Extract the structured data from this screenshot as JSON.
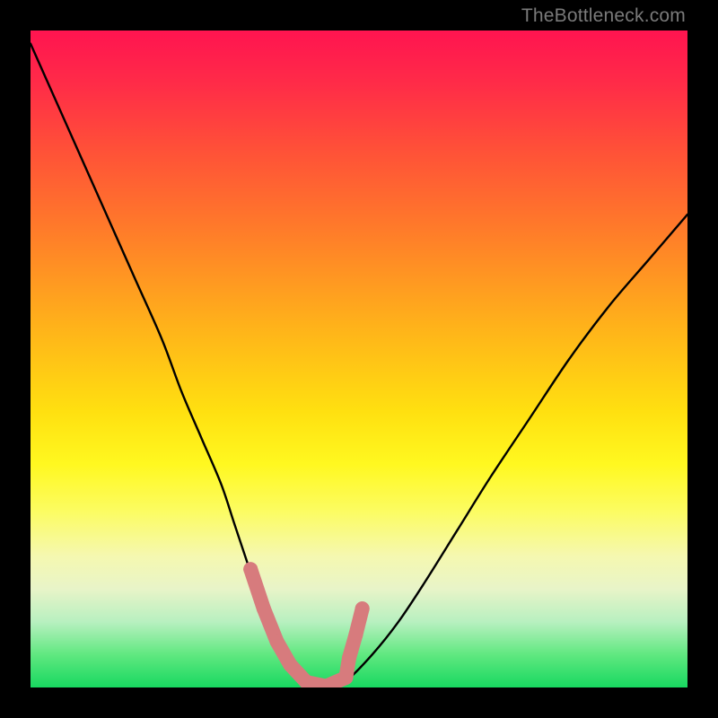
{
  "watermark": "TheBottleneck.com",
  "colors": {
    "page_bg": "#000000",
    "curve": "#000000",
    "marker": "#d77b7d",
    "watermark": "#7a7a7a"
  },
  "chart_data": {
    "type": "line",
    "title": "",
    "xlabel": "",
    "ylabel": "",
    "xlim": [
      0,
      100
    ],
    "ylim": [
      0,
      100
    ],
    "grid": false,
    "legend": false,
    "series": [
      {
        "name": "bottleneck-curve",
        "x": [
          0,
          4,
          8,
          12,
          16,
          20,
          23,
          26,
          29,
          31,
          33,
          35,
          37,
          39,
          42,
          45,
          48,
          52,
          56,
          60,
          65,
          70,
          76,
          82,
          88,
          94,
          100
        ],
        "y": [
          98,
          89,
          80,
          71,
          62,
          53,
          45,
          38,
          31,
          25,
          19,
          13,
          8,
          4,
          1,
          0,
          1,
          5,
          10,
          16,
          24,
          32,
          41,
          50,
          58,
          65,
          72
        ]
      }
    ],
    "markers": {
      "name": "optimal-zone",
      "x": [
        33.5,
        35.5,
        37.5,
        39.5,
        42.0,
        45.0,
        48.0,
        48.5,
        49.5,
        50.5
      ],
      "y": [
        18.0,
        12.0,
        7.0,
        3.5,
        0.8,
        0.2,
        1.5,
        4.5,
        8.0,
        12.0
      ]
    }
  }
}
